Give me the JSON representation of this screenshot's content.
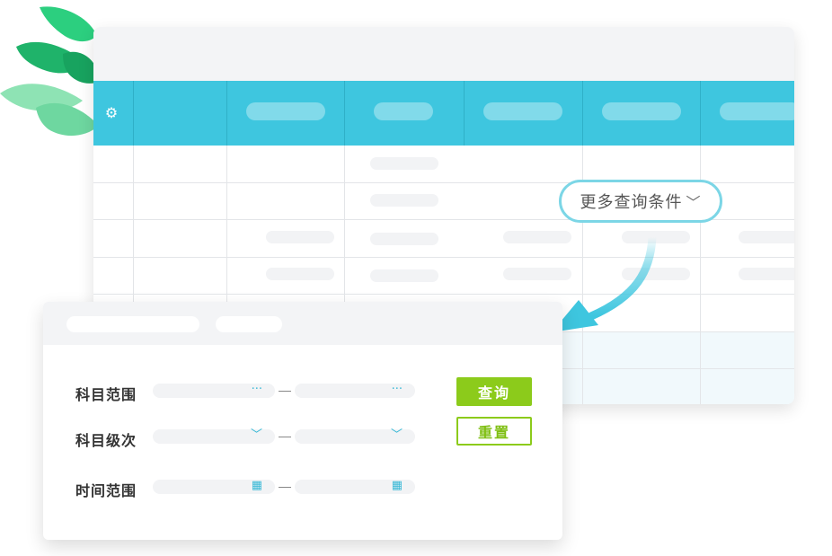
{
  "more_filters": {
    "label": "更多查询条件"
  },
  "query_panel": {
    "rows": [
      {
        "label": "科目范围",
        "icon": "ellipsis-icon"
      },
      {
        "label": "科目级次",
        "icon": "chevron-down-icon"
      },
      {
        "label": "时间范围",
        "icon": "calendar-icon"
      }
    ],
    "query_button": "查询",
    "reset_button": "重置"
  },
  "colors": {
    "header": "#3ec6df",
    "accent_green": "#8ccb1b",
    "chip_border": "#7cd6e6",
    "leaf_dark": "#1fb36a",
    "leaf_light": "#8ee3b4"
  }
}
